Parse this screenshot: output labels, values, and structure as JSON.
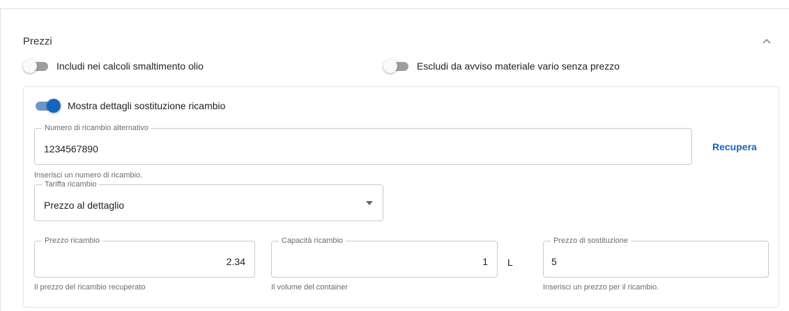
{
  "section": {
    "title": "Prezzi"
  },
  "toggles": {
    "oil_disposal": {
      "label": "Includi nei calcoli smaltimento olio",
      "on": false
    },
    "exclude_misc": {
      "label": "Escludi da avviso materiale vario senza prezzo",
      "on": false
    },
    "show_details": {
      "label": "Mostra dettagli sostituzione ricambio",
      "on": true
    }
  },
  "alt_part": {
    "label": "Numero di ricambio alternativo",
    "value": "1234567890",
    "helper": "Inserisci un numero di ricambio.",
    "action": "Recupera"
  },
  "tariff": {
    "label": "Tariffa ricambio",
    "value": "Prezzo al dettaglio"
  },
  "part_price": {
    "label": "Prezzo ricambio",
    "value": "2.34",
    "helper": "Il prezzo del ricambio recuperato"
  },
  "part_capacity": {
    "label": "Capacità ricambio",
    "value": "1",
    "unit": "L",
    "helper": "Il volume del container"
  },
  "replacement_price": {
    "label": "Prezzo di sostituzione",
    "value": "5",
    "helper": "Inserisci un prezzo per il ricambio."
  },
  "icons": {
    "collapse": "chevron-up-icon",
    "dropdown": "triangle-down-icon"
  },
  "colors": {
    "accent": "#1565c0",
    "accent_track": "#6e97c9",
    "border": "#c8c8c8"
  }
}
